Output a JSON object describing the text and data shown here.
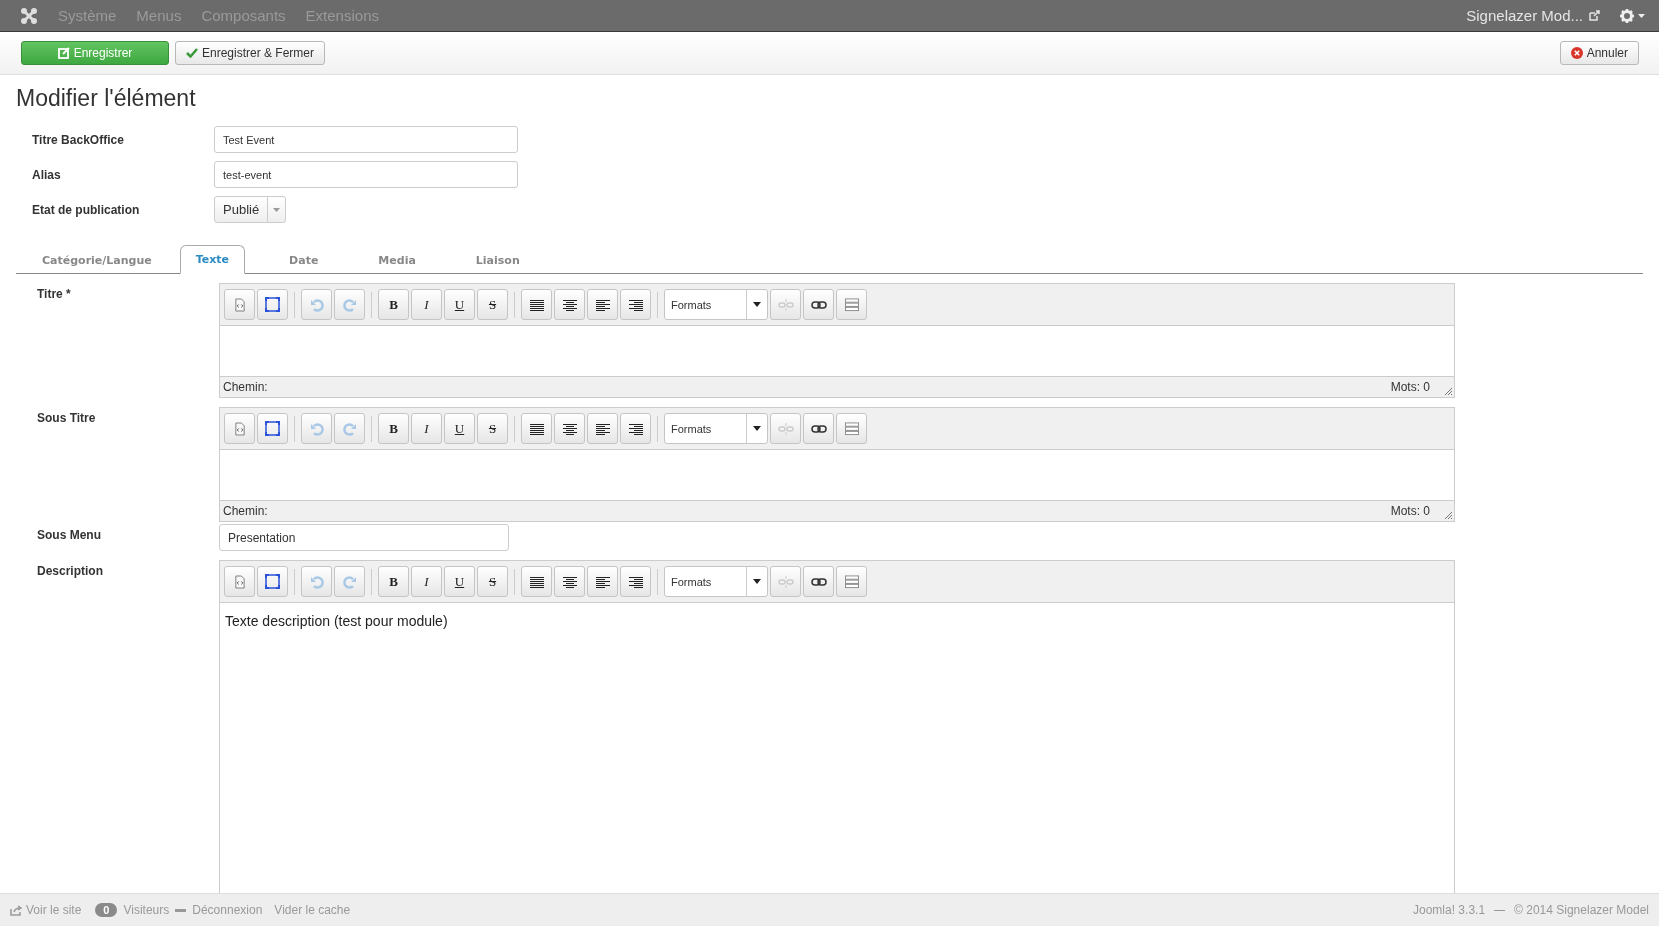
{
  "navbar": {
    "menu": [
      "Système",
      "Menus",
      "Composants",
      "Extensions"
    ],
    "site_link": "Signelazer Mod..."
  },
  "toolbar": {
    "save": "Enregistrer",
    "save_close": "Enregistrer & Fermer",
    "cancel": "Annuler"
  },
  "page_title": "Modifier l'élément",
  "header_fields": [
    {
      "kind": "input",
      "label": "Titre BackOffice",
      "value": "Test Event"
    },
    {
      "kind": "input",
      "label": "Alias",
      "value": "test-event"
    },
    {
      "kind": "select",
      "label": "Etat de publication",
      "value": "Publié"
    }
  ],
  "tabs": [
    {
      "label": "Catégorie/Langue",
      "selected": false
    },
    {
      "label": "Texte",
      "selected": true
    },
    {
      "label": "Date",
      "selected": false
    },
    {
      "label": "Media",
      "selected": false
    },
    {
      "label": "Liaison",
      "selected": false
    }
  ],
  "fields": [
    {
      "kind": "editor",
      "label": "Titre *",
      "letters": [
        "B",
        "I",
        "U",
        "S"
      ],
      "format_select": "Formats",
      "path_label": "Chemin:",
      "word_count": "Mots: 0"
    },
    {
      "kind": "editor",
      "label": "Sous Titre",
      "letters": [
        "B",
        "I",
        "U",
        "S"
      ],
      "format_select": "Formats",
      "path_label": "Chemin:",
      "word_count": "Mots: 0"
    },
    {
      "kind": "input",
      "label": "Sous Menu",
      "value": "Presentation"
    },
    {
      "kind": "editor",
      "label": "Description",
      "letters": [
        "B",
        "I",
        "U",
        "S"
      ],
      "format_select": "Formats",
      "content": "Texte description (test pour module)"
    }
  ],
  "status_bar": {
    "view_site": "Voir le site",
    "visitors_count": "0",
    "visitors": "Visiteurs",
    "logout": "Déconnexion",
    "clear_cache": "Vider le cache",
    "version": "Joomla! 3.3.1",
    "copyright": "© 2014 Signelazer Model"
  }
}
